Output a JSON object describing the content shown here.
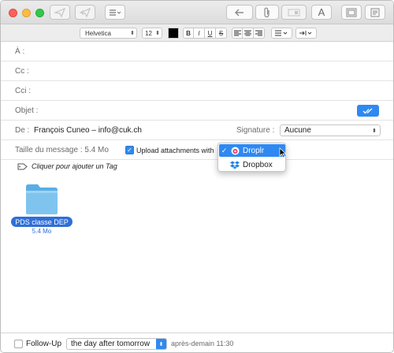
{
  "toolbar": {
    "send_icon": "send-icon",
    "reply_icon": "undo-arrow-icon",
    "attach_icon": "paperclip-icon",
    "fonts_label": "A"
  },
  "format": {
    "font_family": "Helvetica",
    "font_size": "12",
    "bold": "B",
    "italic": "I",
    "underline": "U",
    "strike": "S",
    "text_color": "#000000"
  },
  "fields": {
    "to_label": "À :",
    "cc_label": "Cc :",
    "bcc_label": "Cci :",
    "subject_label": "Objet :",
    "from_label": "De :",
    "from_value": "François Cuneo – info@cuk.ch",
    "signature_label": "Signature :",
    "signature_value": "Aucune",
    "size_label": "Taille du message : 5.4 Mo",
    "upload_label": "Upload attachments with",
    "upload_checked": true,
    "tag_label": "Cliquer pour ajouter un Tag"
  },
  "dropdown": {
    "items": [
      {
        "label": "Droplr",
        "selected": true,
        "icon": "droplr-icon"
      },
      {
        "label": "Dropbox",
        "selected": false,
        "icon": "dropbox-icon"
      }
    ]
  },
  "attachment": {
    "name": "PDS classe DEP",
    "size": "5.4 Mo"
  },
  "footer": {
    "followup_label": "Follow-Up",
    "followup_checked": false,
    "followup_value": "the day after tomorrow",
    "followup_time": "après-demain 11:30"
  },
  "colors": {
    "accent": "#2f89f1",
    "folder": "#7fc4ef"
  }
}
